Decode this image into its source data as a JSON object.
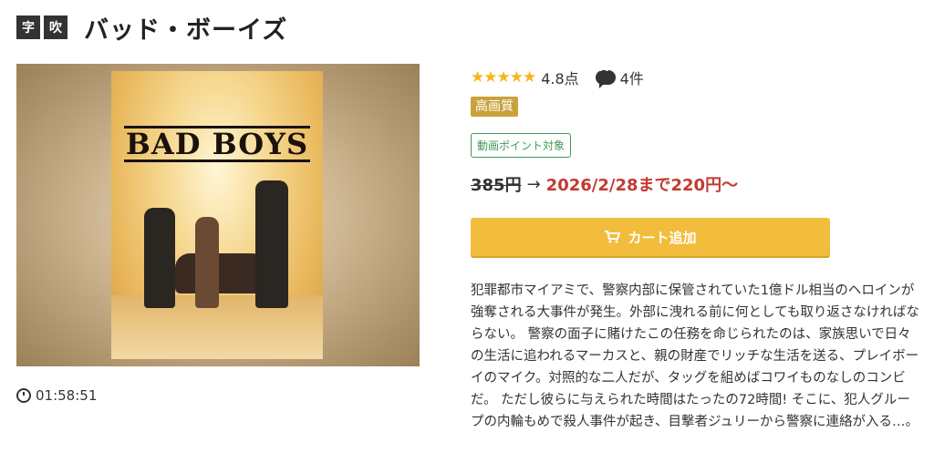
{
  "header": {
    "tag_subtitle": "字",
    "tag_dub": "吹",
    "title": "バッド・ボーイズ"
  },
  "poster": {
    "title": "BAD BOYS"
  },
  "duration": "01:58:51",
  "rating": {
    "stars": "★★★★★",
    "score": "4.8点",
    "comments": "4件"
  },
  "badges": {
    "quality": "高画質",
    "point": "動画ポイント対象"
  },
  "price": {
    "original": "385円",
    "arrow": "→",
    "sale": "2026/2/28まで220円〜"
  },
  "cart": {
    "label": "カート追加"
  },
  "description": "犯罪都市マイアミで、警察内部に保管されていた1億ドル相当のヘロインが強奪される大事件が発生。外部に洩れる前に何としても取り返さなければならない。 警察の面子に賭けたこの任務を命じられたのは、家族思いで日々の生活に追われるマーカスと、親の財産でリッチな生活を送る、プレイボーイのマイク。対照的な二人だが、タッグを組めばコワイものなしのコンビだ。 ただし彼らに与えられた時間はたったの72時間! そこに、犯人グループの内輪もめで殺人事件が起き、目撃者ジュリーから警察に連絡が入る…。",
  "colors": {
    "accent": "#f2bd3c",
    "sale": "#c33a32",
    "point": "#3d9a5a",
    "quality": "#c9a23c",
    "star": "#f4b61b"
  }
}
